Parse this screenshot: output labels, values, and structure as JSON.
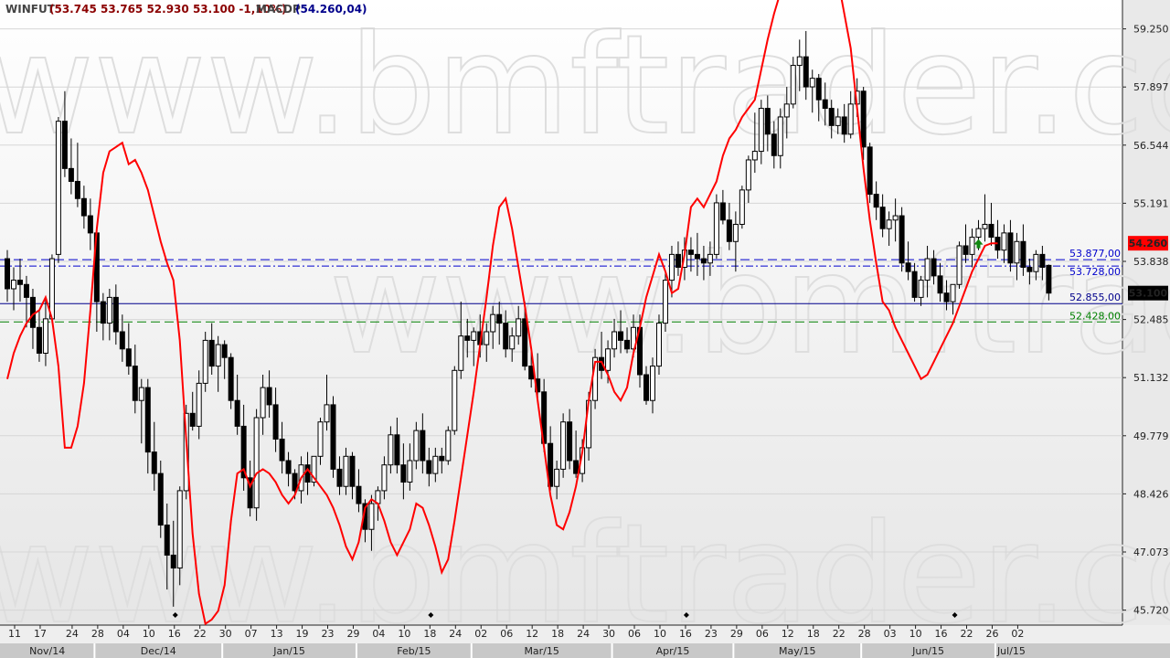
{
  "header": {
    "symbol": "WINFUT",
    "ohlc_text": "(53.745  53.765  52.930  53.100  -1,10%)",
    "indicator": "MACDP",
    "indicator_value": "(54.260,04)",
    "colors": {
      "symbol": "#444444",
      "ohlc": "#8b0000",
      "indicator": "#444444",
      "indicator_value": "#00008b"
    }
  },
  "watermark": {
    "text": "www.bmftrader.com"
  },
  "chart_data": {
    "type": "candlestick",
    "ylim": [
      45400,
      59700
    ],
    "y_ticks": [
      {
        "value": 59250,
        "label": "59.250"
      },
      {
        "value": 57897,
        "label": "57.897"
      },
      {
        "value": 56544,
        "label": "56.544"
      },
      {
        "value": 55191,
        "label": "55.191"
      },
      {
        "value": 53838,
        "label": "53.838"
      },
      {
        "value": 52485,
        "label": "52.485"
      },
      {
        "value": 51132,
        "label": "51.132"
      },
      {
        "value": 49779,
        "label": "49.779"
      },
      {
        "value": 48426,
        "label": "48.426"
      },
      {
        "value": 47073,
        "label": "47.073"
      },
      {
        "value": 45720,
        "label": "45.720"
      }
    ],
    "x_day_labels": [
      {
        "i": 0,
        "label": "11"
      },
      {
        "i": 4,
        "label": "17"
      },
      {
        "i": 9,
        "label": "24"
      },
      {
        "i": 13,
        "label": "28"
      },
      {
        "i": 17,
        "label": "04"
      },
      {
        "i": 21,
        "label": "10"
      },
      {
        "i": 25,
        "label": "16"
      },
      {
        "i": 29,
        "label": "22"
      },
      {
        "i": 33,
        "label": "30"
      },
      {
        "i": 37,
        "label": "07"
      },
      {
        "i": 41,
        "label": "13"
      },
      {
        "i": 45,
        "label": "19"
      },
      {
        "i": 49,
        "label": "23"
      },
      {
        "i": 53,
        "label": "29"
      },
      {
        "i": 57,
        "label": "04"
      },
      {
        "i": 61,
        "label": "10"
      },
      {
        "i": 65,
        "label": "18"
      },
      {
        "i": 69,
        "label": "24"
      },
      {
        "i": 73,
        "label": "02"
      },
      {
        "i": 77,
        "label": "06"
      },
      {
        "i": 81,
        "label": "12"
      },
      {
        "i": 85,
        "label": "18"
      },
      {
        "i": 89,
        "label": "24"
      },
      {
        "i": 93,
        "label": "30"
      },
      {
        "i": 97,
        "label": "06"
      },
      {
        "i": 101,
        "label": "10"
      },
      {
        "i": 105,
        "label": "16"
      },
      {
        "i": 109,
        "label": "23"
      },
      {
        "i": 113,
        "label": "29"
      },
      {
        "i": 117,
        "label": "06"
      },
      {
        "i": 121,
        "label": "12"
      },
      {
        "i": 125,
        "label": "18"
      },
      {
        "i": 129,
        "label": "22"
      },
      {
        "i": 133,
        "label": "28"
      },
      {
        "i": 137,
        "label": "03"
      },
      {
        "i": 141,
        "label": "10"
      },
      {
        "i": 145,
        "label": "16"
      },
      {
        "i": 149,
        "label": "22"
      },
      {
        "i": 153,
        "label": "26"
      },
      {
        "i": 157,
        "label": "02"
      }
    ],
    "months": [
      {
        "label": "Nov/14",
        "start": 0,
        "end": 12
      },
      {
        "label": "Dec/14",
        "start": 13,
        "end": 32
      },
      {
        "label": "Jan/15",
        "start": 33,
        "end": 53
      },
      {
        "label": "Feb/15",
        "start": 54,
        "end": 71
      },
      {
        "label": "Mar/15",
        "start": 72,
        "end": 93
      },
      {
        "label": "Apr/15",
        "start": 94,
        "end": 112
      },
      {
        "label": "May/15",
        "start": 113,
        "end": 132
      },
      {
        "label": "Jun/15",
        "start": 133,
        "end": 153
      },
      {
        "label": "Jul/15",
        "start": 154,
        "end": 158
      }
    ],
    "levels": [
      {
        "value": 53877,
        "label": "53.877,00",
        "color": "#0000cc",
        "style": "dashed"
      },
      {
        "value": 53728,
        "label": "53.728,00",
        "color": "#0000cc",
        "style": "dashdot"
      },
      {
        "value": 52855,
        "label": "52.855,00",
        "color": "#00008b",
        "style": "solid"
      },
      {
        "value": 52428,
        "label": "52.428,00",
        "color": "#008000",
        "style": "dashed"
      }
    ],
    "last_price": {
      "value": 53100,
      "label": "53.100",
      "bg": "#000000"
    },
    "indicator_price": {
      "value": 54260,
      "label": "54.260",
      "bg": "#ff0000"
    },
    "series_colors": {
      "up_fill": "#ffffff",
      "down_fill": "#000000",
      "wick": "#000000",
      "indicator_line": "#ff0000"
    },
    "candles": [
      [
        53900,
        54100,
        52900,
        53200
      ],
      [
        53200,
        53700,
        52700,
        53400
      ],
      [
        53400,
        53900,
        52900,
        53300
      ],
      [
        53300,
        53500,
        52300,
        53000
      ],
      [
        53000,
        53200,
        51800,
        52300
      ],
      [
        52300,
        52700,
        51500,
        51700
      ],
      [
        51700,
        53000,
        51400,
        52500
      ],
      [
        52500,
        54000,
        52400,
        53900
      ],
      [
        54000,
        57200,
        53800,
        57100
      ],
      [
        57100,
        57800,
        55800,
        56000
      ],
      [
        56000,
        56700,
        55400,
        55700
      ],
      [
        55700,
        56600,
        55100,
        55300
      ],
      [
        55300,
        55600,
        54600,
        54900
      ],
      [
        54900,
        55300,
        54100,
        54500
      ],
      [
        54500,
        54600,
        52200,
        52900
      ],
      [
        52900,
        53100,
        52000,
        52400
      ],
      [
        52400,
        53200,
        52000,
        53000
      ],
      [
        53000,
        53300,
        51900,
        52200
      ],
      [
        52200,
        52600,
        51500,
        51800
      ],
      [
        51800,
        52400,
        51200,
        51400
      ],
      [
        51400,
        51900,
        50300,
        50600
      ],
      [
        50600,
        51100,
        49600,
        50900
      ],
      [
        50900,
        51100,
        48900,
        49400
      ],
      [
        49400,
        50100,
        48500,
        48900
      ],
      [
        48900,
        49200,
        47400,
        47700
      ],
      [
        47700,
        48200,
        46200,
        47000
      ],
      [
        47000,
        47800,
        45800,
        46700
      ],
      [
        46700,
        48600,
        46300,
        48500
      ],
      [
        48500,
        50500,
        48300,
        50300
      ],
      [
        50300,
        50800,
        49900,
        50000
      ],
      [
        50000,
        51300,
        49700,
        51000
      ],
      [
        51000,
        52200,
        50800,
        52000
      ],
      [
        52000,
        52400,
        51200,
        51400
      ],
      [
        51400,
        52100,
        50800,
        51900
      ],
      [
        51900,
        52000,
        51100,
        51600
      ],
      [
        51600,
        51700,
        50400,
        50600
      ],
      [
        50600,
        51200,
        49800,
        50000
      ],
      [
        50000,
        50500,
        48500,
        48800
      ],
      [
        48800,
        49200,
        47900,
        48100
      ],
      [
        48100,
        50400,
        47800,
        50200
      ],
      [
        50200,
        51200,
        49800,
        50900
      ],
      [
        50900,
        51300,
        50200,
        50500
      ],
      [
        50500,
        50900,
        49400,
        49700
      ],
      [
        49700,
        50100,
        48900,
        49200
      ],
      [
        49200,
        49400,
        48600,
        48900
      ],
      [
        48900,
        49000,
        48300,
        48500
      ],
      [
        48500,
        49300,
        48200,
        49100
      ],
      [
        49100,
        49400,
        48400,
        48700
      ],
      [
        48700,
        49300,
        48600,
        49300
      ],
      [
        49300,
        50200,
        49100,
        50100
      ],
      [
        50100,
        51200,
        49900,
        50500
      ],
      [
        50500,
        50700,
        48800,
        49000
      ],
      [
        49000,
        49300,
        48400,
        48600
      ],
      [
        48600,
        49500,
        48400,
        49300
      ],
      [
        49300,
        49400,
        48300,
        48600
      ],
      [
        48600,
        49000,
        48000,
        48200
      ],
      [
        48200,
        48300,
        47300,
        47600
      ],
      [
        47600,
        48400,
        47100,
        48200
      ],
      [
        48200,
        48600,
        47800,
        48500
      ],
      [
        48500,
        49300,
        48300,
        49100
      ],
      [
        49100,
        50000,
        48900,
        49800
      ],
      [
        49800,
        50200,
        48900,
        49100
      ],
      [
        49100,
        49600,
        48300,
        48700
      ],
      [
        48700,
        49600,
        48500,
        49200
      ],
      [
        49200,
        50100,
        49000,
        49900
      ],
      [
        49900,
        50300,
        48900,
        49200
      ],
      [
        49200,
        49500,
        48600,
        48900
      ],
      [
        48900,
        49500,
        48700,
        49300
      ],
      [
        49300,
        49500,
        48900,
        49200
      ],
      [
        49200,
        50000,
        49100,
        49900
      ],
      [
        49900,
        51400,
        49800,
        51300
      ],
      [
        51300,
        52900,
        51100,
        52100
      ],
      [
        52100,
        52500,
        51600,
        52000
      ],
      [
        52000,
        52300,
        51400,
        52200
      ],
      [
        52200,
        52600,
        51600,
        51900
      ],
      [
        51900,
        52400,
        51500,
        52200
      ],
      [
        52200,
        52800,
        51800,
        52600
      ],
      [
        52600,
        52900,
        51900,
        52400
      ],
      [
        52400,
        52700,
        51600,
        51800
      ],
      [
        51800,
        52300,
        51500,
        52100
      ],
      [
        52100,
        52800,
        51900,
        52500
      ],
      [
        52500,
        52900,
        51300,
        51400
      ],
      [
        51400,
        51800,
        50900,
        51100
      ],
      [
        51100,
        51700,
        50600,
        50800
      ],
      [
        50800,
        51100,
        49400,
        49600
      ],
      [
        49600,
        50000,
        48500,
        48600
      ],
      [
        48600,
        49200,
        48300,
        49000
      ],
      [
        49000,
        50300,
        48800,
        50100
      ],
      [
        50100,
        50400,
        49000,
        49200
      ],
      [
        49200,
        49900,
        48800,
        48900
      ],
      [
        48900,
        49700,
        48700,
        49500
      ],
      [
        49500,
        50800,
        49200,
        50600
      ],
      [
        50600,
        51800,
        50400,
        51600
      ],
      [
        51600,
        52200,
        51100,
        51300
      ],
      [
        51300,
        52000,
        51000,
        51800
      ],
      [
        51800,
        52500,
        51600,
        52200
      ],
      [
        52200,
        52700,
        51700,
        52000
      ],
      [
        52000,
        52300,
        51700,
        51800
      ],
      [
        51800,
        52600,
        51600,
        52300
      ],
      [
        52300,
        52600,
        50900,
        51200
      ],
      [
        51200,
        51400,
        50500,
        50600
      ],
      [
        50600,
        51600,
        50300,
        51400
      ],
      [
        51400,
        52600,
        51200,
        52400
      ],
      [
        52400,
        53600,
        52200,
        53400
      ],
      [
        53400,
        54200,
        53000,
        54000
      ],
      [
        54000,
        54300,
        53500,
        53700
      ],
      [
        53700,
        54400,
        53400,
        54100
      ],
      [
        54100,
        54400,
        53600,
        54000
      ],
      [
        54000,
        54500,
        53500,
        53900
      ],
      [
        53900,
        54200,
        53400,
        53800
      ],
      [
        53800,
        54300,
        53500,
        54000
      ],
      [
        54000,
        55400,
        53900,
        55200
      ],
      [
        55200,
        55500,
        54700,
        54800
      ],
      [
        54800,
        55200,
        54100,
        54300
      ],
      [
        54300,
        55000,
        53600,
        54700
      ],
      [
        54700,
        55600,
        54600,
        55500
      ],
      [
        55500,
        56300,
        55200,
        56200
      ],
      [
        56200,
        57300,
        55900,
        56400
      ],
      [
        56400,
        57600,
        56100,
        57400
      ],
      [
        57400,
        57700,
        56400,
        56800
      ],
      [
        56800,
        57100,
        56000,
        56300
      ],
      [
        56300,
        57400,
        56000,
        57200
      ],
      [
        57200,
        57900,
        56700,
        57500
      ],
      [
        57500,
        58600,
        57400,
        58400
      ],
      [
        58400,
        59000,
        57800,
        58600
      ],
      [
        58600,
        59200,
        57600,
        57900
      ],
      [
        57900,
        58300,
        57300,
        58100
      ],
      [
        58100,
        58200,
        57100,
        57600
      ],
      [
        57600,
        58000,
        57000,
        57400
      ],
      [
        57400,
        57600,
        56700,
        57000
      ],
      [
        57000,
        57400,
        56800,
        57200
      ],
      [
        57200,
        57500,
        56600,
        56800
      ],
      [
        56800,
        57800,
        56700,
        57500
      ],
      [
        57500,
        58100,
        57200,
        57800
      ],
      [
        57800,
        57900,
        56200,
        56500
      ],
      [
        56500,
        56600,
        55200,
        55400
      ],
      [
        55400,
        55700,
        54800,
        55100
      ],
      [
        55100,
        55400,
        54400,
        54600
      ],
      [
        54600,
        55000,
        54200,
        54800
      ],
      [
        54800,
        55300,
        54300,
        54900
      ],
      [
        54900,
        55100,
        53600,
        53800
      ],
      [
        53800,
        54300,
        53400,
        53600
      ],
      [
        53600,
        53800,
        52900,
        53000
      ],
      [
        53000,
        53500,
        52800,
        53400
      ],
      [
        53400,
        54200,
        53000,
        53900
      ],
      [
        53900,
        54100,
        53300,
        53500
      ],
      [
        53500,
        53800,
        52900,
        53100
      ],
      [
        53100,
        53400,
        52700,
        52900
      ],
      [
        52900,
        53200,
        52600,
        53300
      ],
      [
        53300,
        54300,
        53200,
        54200
      ],
      [
        54200,
        54700,
        53800,
        54000
      ],
      [
        54000,
        54600,
        53700,
        54400
      ],
      [
        54400,
        54800,
        54100,
        54600
      ],
      [
        54600,
        55400,
        54300,
        54700
      ],
      [
        54700,
        55200,
        54200,
        54400
      ],
      [
        54400,
        54800,
        53900,
        54100
      ],
      [
        54100,
        54700,
        53800,
        54500
      ],
      [
        54500,
        54800,
        53600,
        53800
      ],
      [
        53800,
        54500,
        53400,
        54300
      ],
      [
        54300,
        54700,
        53500,
        53700
      ],
      [
        53700,
        53900,
        53300,
        53600
      ],
      [
        53600,
        54100,
        53400,
        54000
      ],
      [
        54000,
        54200,
        53400,
        53700
      ],
      [
        53745,
        53765,
        52930,
        53100
      ]
    ],
    "indicator_series": [
      51100,
      51700,
      52100,
      52400,
      52600,
      52700,
      53000,
      52500,
      51400,
      49500,
      49500,
      50000,
      51000,
      52700,
      54600,
      55900,
      56400,
      56500,
      56600,
      56100,
      56200,
      55900,
      55500,
      54900,
      54300,
      53800,
      53400,
      52000,
      49700,
      47500,
      46100,
      45400,
      45500,
      45700,
      46300,
      47800,
      48900,
      49000,
      48600,
      48900,
      49000,
      48900,
      48700,
      48400,
      48200,
      48400,
      48800,
      49000,
      48800,
      48600,
      48400,
      48100,
      47700,
      47200,
      46900,
      47300,
      48100,
      48300,
      48200,
      47800,
      47300,
      47000,
      47300,
      47600,
      48200,
      48100,
      47700,
      47200,
      46600,
      46900,
      47800,
      48800,
      49800,
      50800,
      51900,
      53000,
      54200,
      55100,
      55300,
      54600,
      53700,
      52800,
      51800,
      50600,
      49500,
      48400,
      47700,
      47600,
      48000,
      48600,
      49400,
      50600,
      51500,
      51500,
      51200,
      50800,
      50600,
      50900,
      51700,
      52300,
      53000,
      53500,
      54000,
      53600,
      53100,
      53200,
      54000,
      55100,
      55300,
      55100,
      55400,
      55700,
      56300,
      56700,
      56900,
      57200,
      57400,
      57600,
      58300,
      59000,
      59600,
      60100,
      60400,
      60800,
      61300,
      61600,
      61700,
      61600,
      61300,
      60900,
      60400,
      59600,
      58800,
      57400,
      56000,
      54800,
      53800,
      52900,
      52700,
      52300,
      52000,
      51700,
      51400,
      51100,
      51200,
      51500,
      51800,
      52100,
      52400,
      52800,
      53200,
      53600,
      53900,
      54200,
      54260,
      54260
    ],
    "arrow_index": 152,
    "arrow_color": "#118811",
    "marker_indices": [
      26,
      66,
      106,
      148
    ]
  }
}
